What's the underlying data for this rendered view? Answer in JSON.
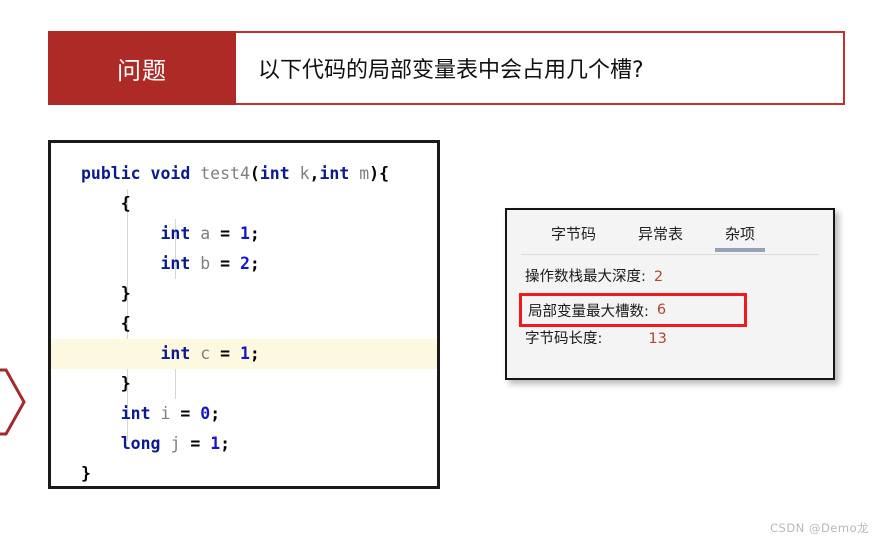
{
  "banner": {
    "label": "问题",
    "title": "以下代码的局部变量表中会占用几个槽?",
    "label_bg": "#ad2a26",
    "border_color": "#c4302b"
  },
  "code_panel": {
    "lines": [
      {
        "indent": 0,
        "highlight": false,
        "tokens": [
          {
            "t": "public",
            "c": "kw"
          },
          {
            "t": " ",
            "c": "op"
          },
          {
            "t": "void",
            "c": "kw"
          },
          {
            "t": " ",
            "c": "op"
          },
          {
            "t": "test4",
            "c": "meth"
          },
          {
            "t": "(",
            "c": "brc"
          },
          {
            "t": "int",
            "c": "kw"
          },
          {
            "t": " ",
            "c": "op"
          },
          {
            "t": "k",
            "c": "var"
          },
          {
            "t": ",",
            "c": "brc"
          },
          {
            "t": "int",
            "c": "kw"
          },
          {
            "t": " ",
            "c": "op"
          },
          {
            "t": "m",
            "c": "var"
          },
          {
            "t": "){",
            "c": "brc"
          }
        ]
      },
      {
        "indent": 1,
        "highlight": false,
        "tokens": [
          {
            "t": "{",
            "c": "brc"
          }
        ]
      },
      {
        "indent": 2,
        "highlight": false,
        "tokens": [
          {
            "t": "int",
            "c": "kw"
          },
          {
            "t": " ",
            "c": "op"
          },
          {
            "t": "a",
            "c": "var"
          },
          {
            "t": " ",
            "c": "op"
          },
          {
            "t": "=",
            "c": "op"
          },
          {
            "t": " ",
            "c": "op"
          },
          {
            "t": "1",
            "c": "num"
          },
          {
            "t": ";",
            "c": "op"
          }
        ]
      },
      {
        "indent": 2,
        "highlight": false,
        "tokens": [
          {
            "t": "int",
            "c": "kw"
          },
          {
            "t": " ",
            "c": "op"
          },
          {
            "t": "b",
            "c": "var"
          },
          {
            "t": " ",
            "c": "op"
          },
          {
            "t": "=",
            "c": "op"
          },
          {
            "t": " ",
            "c": "op"
          },
          {
            "t": "2",
            "c": "num"
          },
          {
            "t": ";",
            "c": "op"
          }
        ]
      },
      {
        "indent": 1,
        "highlight": false,
        "tokens": [
          {
            "t": "}",
            "c": "brc"
          }
        ]
      },
      {
        "indent": 1,
        "highlight": false,
        "tokens": [
          {
            "t": "{",
            "c": "brc"
          }
        ]
      },
      {
        "indent": 2,
        "highlight": true,
        "tokens": [
          {
            "t": "int",
            "c": "kw"
          },
          {
            "t": " ",
            "c": "op"
          },
          {
            "t": "c",
            "c": "var"
          },
          {
            "t": " ",
            "c": "op"
          },
          {
            "t": "=",
            "c": "op"
          },
          {
            "t": " ",
            "c": "op"
          },
          {
            "t": "1",
            "c": "num"
          },
          {
            "t": ";",
            "c": "op"
          }
        ]
      },
      {
        "indent": 1,
        "highlight": false,
        "tokens": [
          {
            "t": "}",
            "c": "brc"
          }
        ]
      },
      {
        "indent": 1,
        "highlight": false,
        "tokens": [
          {
            "t": "int",
            "c": "kw"
          },
          {
            "t": " ",
            "c": "op"
          },
          {
            "t": "i",
            "c": "var"
          },
          {
            "t": " ",
            "c": "op"
          },
          {
            "t": "=",
            "c": "op"
          },
          {
            "t": " ",
            "c": "op"
          },
          {
            "t": "0",
            "c": "num"
          },
          {
            "t": ";",
            "c": "op"
          }
        ]
      },
      {
        "indent": 1,
        "highlight": false,
        "tokens": [
          {
            "t": "long",
            "c": "kw"
          },
          {
            "t": " ",
            "c": "op"
          },
          {
            "t": "j",
            "c": "var"
          },
          {
            "t": " ",
            "c": "op"
          },
          {
            "t": "=",
            "c": "op"
          },
          {
            "t": " ",
            "c": "op"
          },
          {
            "t": "1",
            "c": "num"
          },
          {
            "t": ";",
            "c": "op"
          }
        ]
      },
      {
        "indent": 0,
        "highlight": false,
        "tokens": [
          {
            "t": "}",
            "c": "brc"
          }
        ]
      }
    ],
    "highlight_color": "#fdf8e0",
    "keyword_color": "#0b1a8c",
    "number_color": "#1616c8"
  },
  "info_panel": {
    "tabs": [
      {
        "label": "字节码",
        "active": false
      },
      {
        "label": "异常表",
        "active": false
      },
      {
        "label": "杂项",
        "active": true
      }
    ],
    "rows": [
      {
        "label": "操作数栈最大深度:",
        "value": "2",
        "boxed": false,
        "wide": false
      },
      {
        "label": "局部变量最大槽数:",
        "value": "6",
        "boxed": true,
        "wide": false
      },
      {
        "label": "字节码长度:",
        "value": "13",
        "boxed": false,
        "wide": true
      }
    ],
    "active_tab_underline_color": "#94a3b8",
    "highlight_box_color": "#ef1b1b",
    "value_color": "#b5432e"
  },
  "chevron": {
    "stroke_color": "#a32b2b"
  },
  "watermark": {
    "text": "CSDN @Demo龙"
  }
}
